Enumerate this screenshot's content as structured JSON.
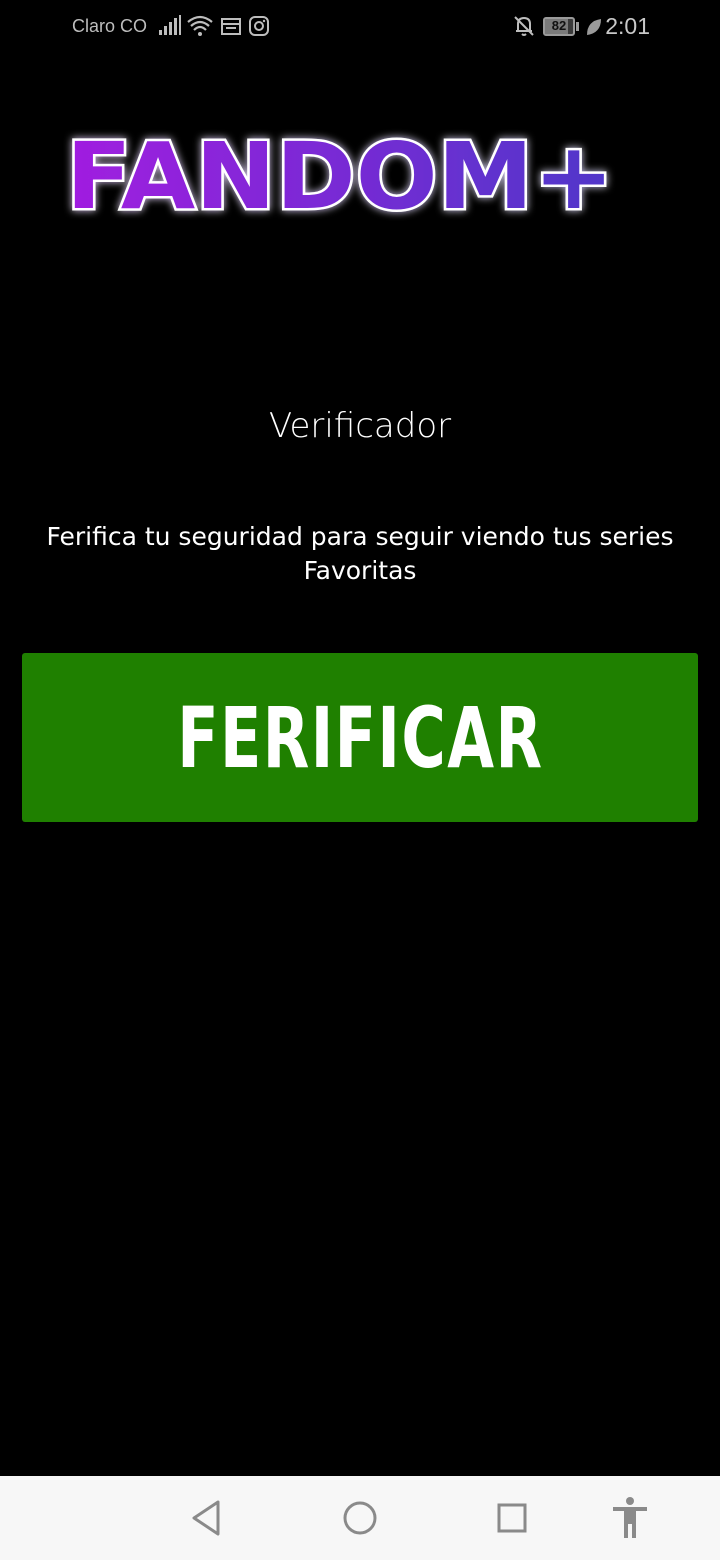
{
  "status_bar": {
    "carrier": "Claro CO",
    "battery_level": "82",
    "battery_fraction": 0.82,
    "time": "2:01",
    "icons": [
      "signal-icon",
      "wifi-icon",
      "calendar-icon",
      "instagram-icon",
      "bell-muted-icon",
      "battery-icon",
      "leaf-icon"
    ]
  },
  "logo": {
    "text": "FANDOM+",
    "colors": {
      "start": "#a11ee0",
      "end": "#4f37c9",
      "glow": "#ffffff"
    }
  },
  "main": {
    "title": "Verificador",
    "description": "Ferifica tu seguridad para seguir viendo tus series Favoritas",
    "button_label": "FERIFICAR",
    "button_color": "#1f8000"
  },
  "nav_bar": {
    "icons": [
      "back-icon",
      "home-icon",
      "recents-icon",
      "accessibility-icon"
    ]
  }
}
